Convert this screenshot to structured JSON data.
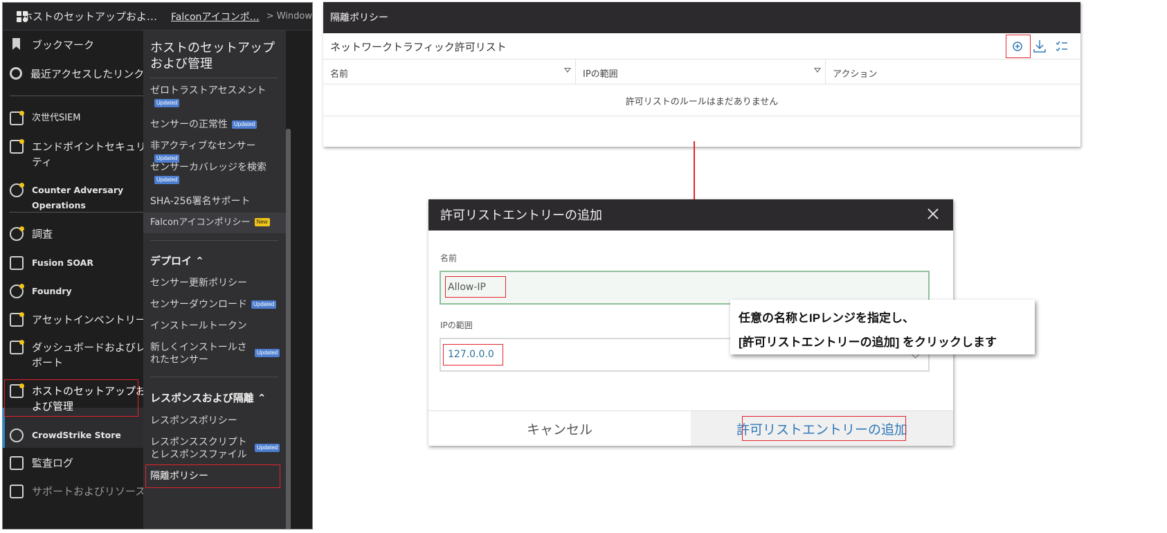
{
  "console": {
    "topbar": {
      "section": "ホストのセットアップおよ…",
      "breadcrumb_link": "Falconアイコンポ…",
      "breadcrumb_next": "> Windows"
    },
    "left_nav": [
      {
        "label": "ブックマーク",
        "icon": "bookmark-icon"
      },
      {
        "label": "最近アクセスしたリンク",
        "icon": "clock-icon"
      },
      {
        "label": "次世代SIEM",
        "icon": "siem-icon"
      },
      {
        "label": "エンドポイントセキュリティ",
        "icon": "endpoint-icon"
      },
      {
        "label": "Counter Adversary Operations",
        "icon": "adversary-icon"
      },
      {
        "label": "調査",
        "icon": "investigate-icon"
      },
      {
        "label": "Fusion SOAR",
        "icon": "workflow-icon"
      },
      {
        "label": "Foundry",
        "icon": "foundry-icon"
      },
      {
        "label": "アセットインベントリー",
        "icon": "asset-icon"
      },
      {
        "label": "ダッシュボードおよびレポート",
        "icon": "dashboard-icon"
      },
      {
        "label": "ホストのセットアップおよび管理",
        "icon": "host-setup-icon"
      },
      {
        "label": "CrowdStrike Store",
        "icon": "store-icon"
      },
      {
        "label": "監査ログ",
        "icon": "audit-log-icon"
      },
      {
        "label": "サポートおよびリソース",
        "icon": "support-icon"
      }
    ],
    "sub_panel": {
      "title": "ホストのセットアップおよび管理",
      "items": [
        {
          "label": "ゼロトラストアセスメント",
          "badge": "Updated"
        },
        {
          "label": "センサーの正常性",
          "badge": "Updated"
        },
        {
          "label": "非アクティブなセンサー",
          "badge": "Updated"
        },
        {
          "label": "センサーカバレッジを検索",
          "badge": "Updated"
        },
        {
          "label": "SHA-256署名サポート",
          "badge": ""
        },
        {
          "label": "Falconアイコンポリシー",
          "badge": "New"
        }
      ],
      "deploy_header": "デプロイ ⌃",
      "deploy_items": [
        {
          "label": "センサー更新ポリシー",
          "badge": ""
        },
        {
          "label": "センサーダウンロード",
          "badge": "Updated"
        },
        {
          "label": "インストールトークン",
          "badge": ""
        },
        {
          "label": "新しくインストールされたセンサー",
          "badge": "Updated"
        }
      ],
      "response_header": "レスポンスおよび隔離 ⌃",
      "response_items": [
        {
          "label": "レスポンスポリシー",
          "badge": ""
        },
        {
          "label": "レスポンススクリプトとレスポンスファイル",
          "badge": "Updated"
        },
        {
          "label": "隔離ポリシー",
          "badge": ""
        }
      ]
    }
  },
  "panel": {
    "title": "隔離ポリシー",
    "subtitle": "ネットワークトラフィック許可リスト",
    "columns": [
      "名前",
      "IPの範囲",
      "アクション"
    ],
    "empty_text": "許可リストのルールはまだありません"
  },
  "dialog": {
    "title": "許可リストエントリーの追加",
    "name_label": "名前",
    "name_value": "Allow-IP",
    "ip_label": "IPの範囲",
    "ip_value": "127.0.0.0",
    "cancel_label": "キャンセル",
    "add_label": "許可リストエントリーの追加"
  },
  "callout": {
    "line1": "任意の名称とIPレンジを指定し、",
    "line2": "[許可リストエントリーの追加] をクリックします"
  },
  "colors": {
    "highlight": "#e3232b",
    "accent": "#2f78b8",
    "badge_updated": "#4d7ecf",
    "badge_new": "#f0c419"
  }
}
